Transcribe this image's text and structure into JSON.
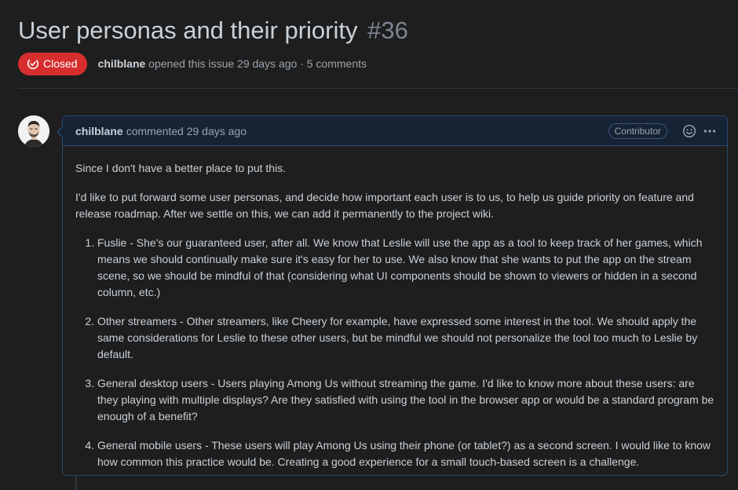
{
  "issue": {
    "title": "User personas and their priority",
    "number": "#36",
    "state_label": "Closed",
    "state_color": "#d62e2e",
    "author": "chilblane",
    "meta_text": "opened this issue 29 days ago · 5 comments"
  },
  "comment": {
    "author": "chilblane",
    "meta_text": "commented 29 days ago",
    "role_badge": "Contributor",
    "reaction_icon": "smiley-icon",
    "menu_icon": "kebab-horizontal-icon",
    "intro": "Since I don't have a better place to put this.",
    "paragraph": "I'd like to put forward some user personas, and decide how important each user is to us, to help us guide priority on feature and release roadmap. After we settle on this, we can add it permanently to the project wiki.",
    "items": [
      "Fuslie - She's our guaranteed user, after all. We know that Leslie will use the app as a tool to keep track of her games, which means we should continually make sure it's easy for her to use. We also know that she wants to put the app on the stream scene, so we should be mindful of that (considering what UI components should be shown to viewers or hidden in a second column, etc.)",
      "Other streamers - Other streamers, like Cheery for example, have expressed some interest in the tool. We should apply the same considerations for Leslie to these other users, but be mindful we should not personalize the tool too much to Leslie by default.",
      "General desktop users - Users playing Among Us without streaming the game. I'd like to know more about these users: are they playing with multiple displays? Are they satisfied with using the tool in the browser app or would be a standard program be enough of a benefit?",
      "General mobile users - These users will play Among Us using their phone (or tablet?) as a second screen. I would like to know how common this practice would be. Creating a good experience for a small touch-based screen is a challenge."
    ]
  },
  "colors": {
    "background": "#1e1e1e",
    "comment_header_bg": "#162335",
    "comment_border": "#2b4a6e",
    "text": "#c9d1d9",
    "muted": "#9aa4ae"
  }
}
